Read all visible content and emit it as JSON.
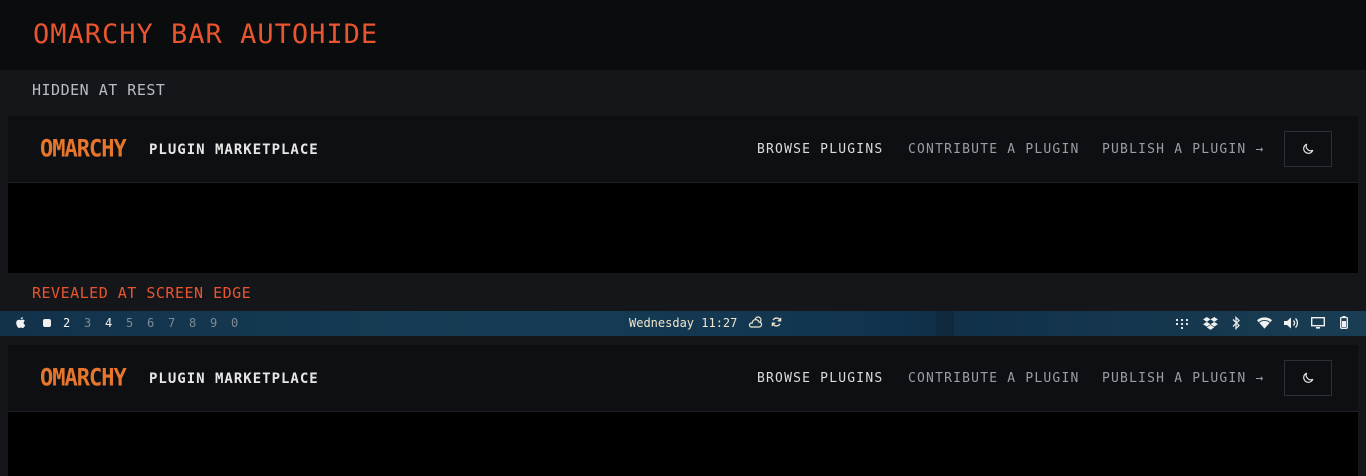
{
  "page": {
    "title": "OMARCHY BAR AUTOHIDE",
    "section_hidden": "HIDDEN AT REST",
    "section_revealed": "REVEALED AT SCREEN EDGE"
  },
  "site": {
    "logo": "OMARCHY",
    "brand": "PLUGIN MARKETPLACE",
    "nav": {
      "browse": "BROWSE PLUGINS",
      "contribute": "CONTRIBUTE A PLUGIN",
      "publish": "PUBLISH A PLUGIN →"
    }
  },
  "waybar": {
    "workspaces": [
      "2",
      "3",
      "4",
      "5",
      "6",
      "7",
      "8",
      "9",
      "0"
    ],
    "active_workspaces": [
      "2",
      "4"
    ],
    "clock": "Wednesday 11:27"
  },
  "colors": {
    "accent": "#e8552f",
    "logo": "#e6762c"
  }
}
